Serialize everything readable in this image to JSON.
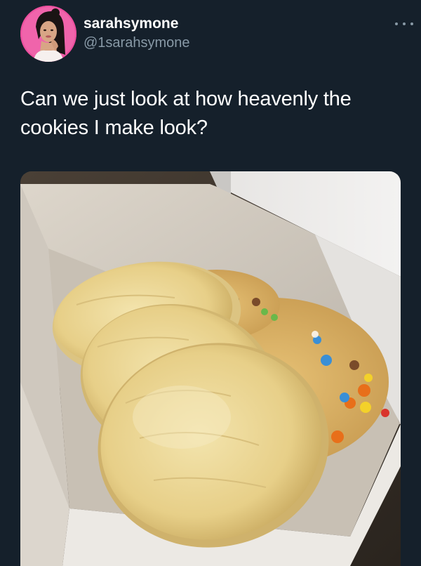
{
  "tweet": {
    "display_name": "sarahsymone",
    "handle": "@1sarahsymone",
    "text": "Can we just look at how heavenly the cookies I make look?",
    "more_icon": "more-dots-icon"
  },
  "media": {
    "subject": "cookies-in-box-photo"
  },
  "colors": {
    "background": "#15202b",
    "secondary_text": "#8899a6",
    "avatar_bg": "#e94fa0"
  }
}
